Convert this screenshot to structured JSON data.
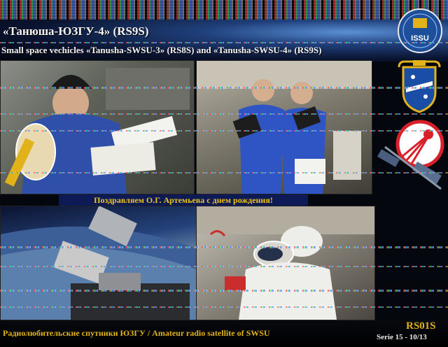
{
  "title": "«Танюша-ЮЗГУ-4» (RS9S)",
  "subtitle": "Small space vechicles «Tanusha-SWSU-3» (RS8S) and «Tanusha-SWSU-4» (RS9S)",
  "congratulation": "Поздравляем О.Г. Артемьева с днем рождения!",
  "footer": {
    "caption": "Радиолюбительские спутники ЮЗГУ / Amateur radio satellite of SWSU",
    "callsign": "RS01S",
    "serie": "Serie 15 - 10/13"
  },
  "logos": {
    "issu": "ISSU",
    "accent_colors": {
      "gold": "#e1b21a",
      "red": "#d8202a",
      "blue": "#0d1a55"
    }
  },
  "photos": [
    {
      "id": "photo-cosmonaut-with-satellites"
    },
    {
      "id": "photo-two-crew-holding-satellites"
    },
    {
      "id": "photo-satellite-deployment-in-orbit"
    },
    {
      "id": "photo-spacesuit-in-station"
    }
  ]
}
